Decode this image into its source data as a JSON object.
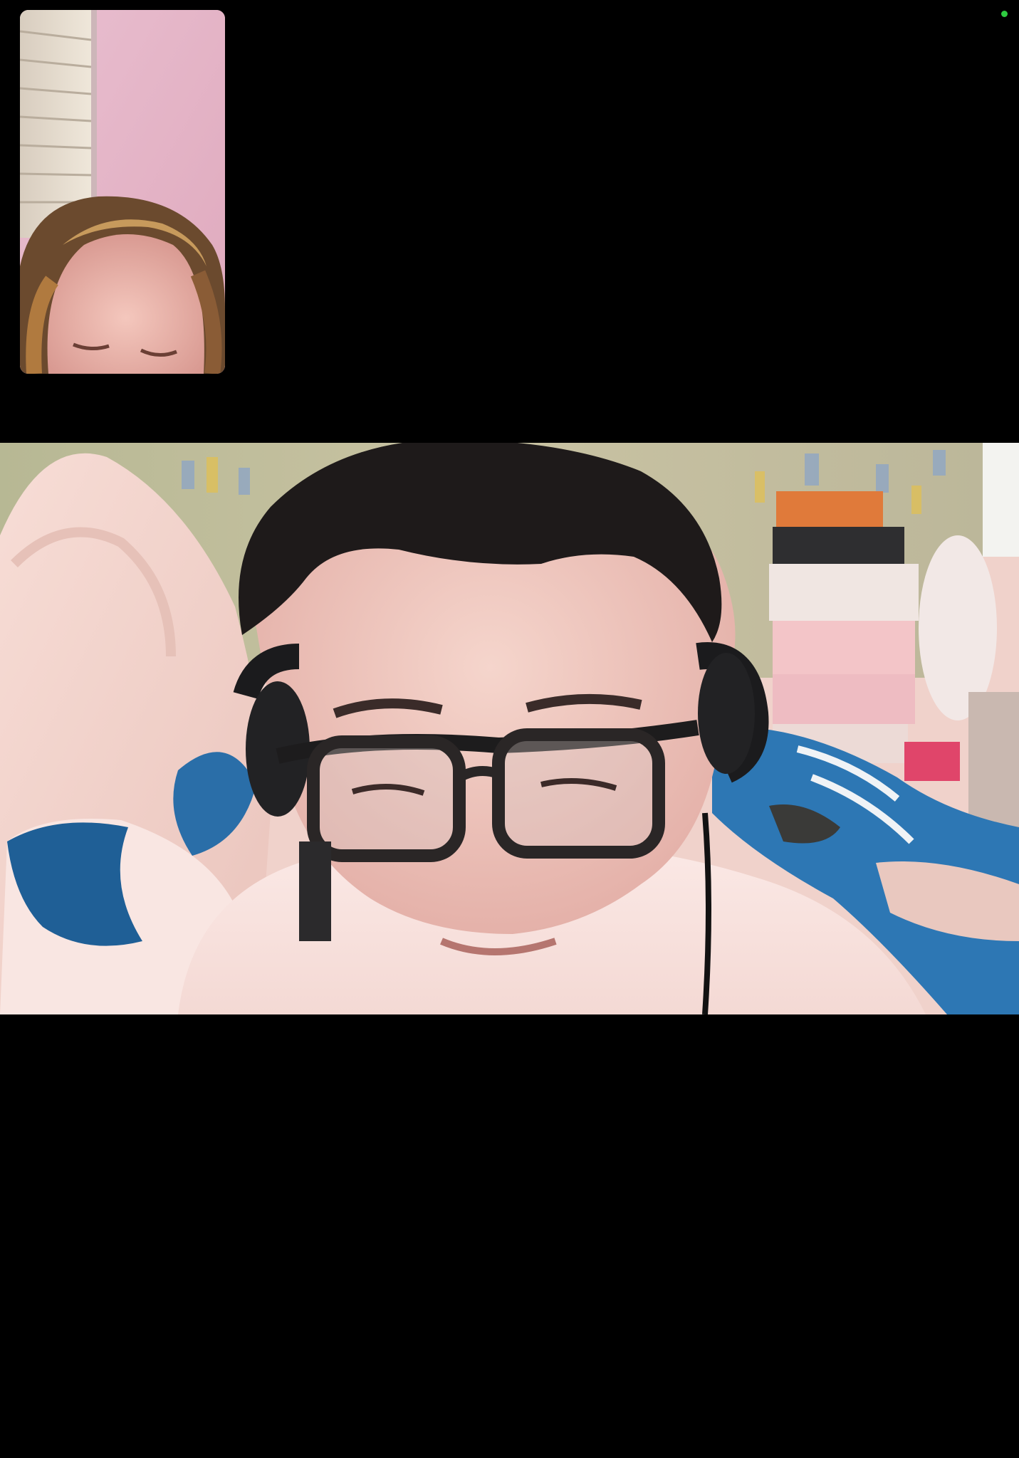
{
  "call": {
    "status_indicator_color": "#2ecc40",
    "background_color": "#000000",
    "self_view": {
      "description_icon": "self-camera-feed"
    },
    "main_view": {
      "description_icon": "remote-camera-feed"
    }
  }
}
